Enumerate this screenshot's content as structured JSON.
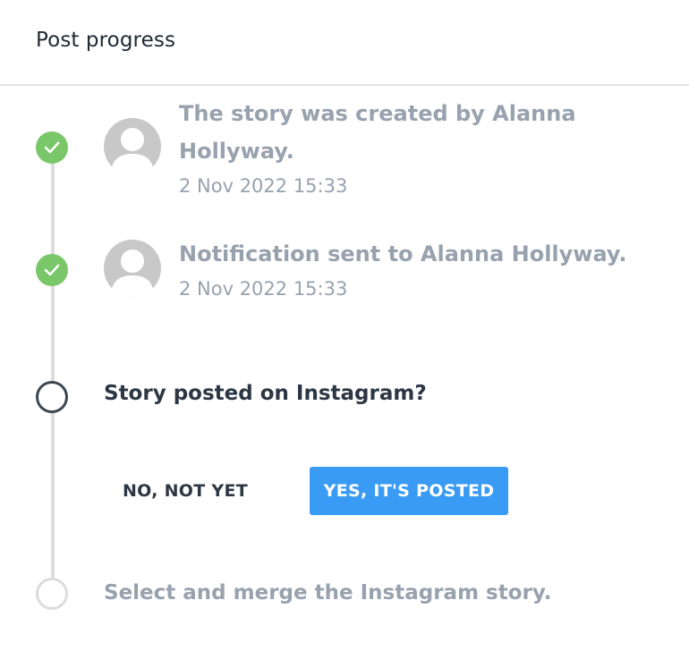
{
  "header": {
    "title": "Post progress"
  },
  "events": [
    {
      "text": "The story was created by Alanna Hollyway.",
      "time": "2 Nov 2022 15:33"
    },
    {
      "text": "Notification sent to Alanna Hollyway.",
      "time": "2 Nov 2022 15:33"
    }
  ],
  "current_step": {
    "question": "Story posted on Instagram?",
    "no_label": "NO, NOT YET",
    "yes_label": "YES, IT'S POSTED"
  },
  "next_step": {
    "label": "Select and merge the Instagram story."
  },
  "colors": {
    "done": "#79c768",
    "current_ring": "#3d4852",
    "pending_ring": "#dcdcdc",
    "primary_button": "#3a9bf4",
    "muted_text": "#98a2ae"
  },
  "icons": {
    "done_step": "check-icon",
    "user": "user-avatar-icon"
  }
}
